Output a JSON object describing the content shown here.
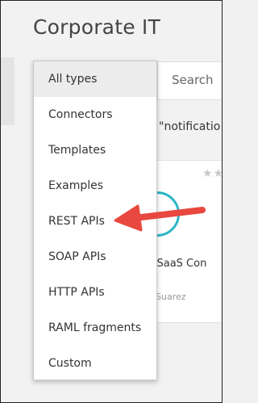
{
  "header": {
    "title": "Corporate IT"
  },
  "search": {
    "placeholder": "Search",
    "query_display": "\"notificatio"
  },
  "asset_card": {
    "stars": "★★",
    "name": "r SaaS Con",
    "author": "Suarez"
  },
  "type_dropdown": {
    "selected": "All types",
    "options": [
      {
        "label": "All types"
      },
      {
        "label": "Connectors"
      },
      {
        "label": "Templates"
      },
      {
        "label": "Examples"
      },
      {
        "label": "REST APIs"
      },
      {
        "label": "SOAP APIs"
      },
      {
        "label": "HTTP APIs"
      },
      {
        "label": "RAML fragments"
      },
      {
        "label": "Custom"
      }
    ]
  },
  "annotation": {
    "icon": "arrow-left-icon",
    "color": "#e8483f",
    "points_to": "REST APIs"
  },
  "colors": {
    "accent": "#2bb5c5",
    "arrow": "#e8483f",
    "selected_bg": "#ececec"
  }
}
